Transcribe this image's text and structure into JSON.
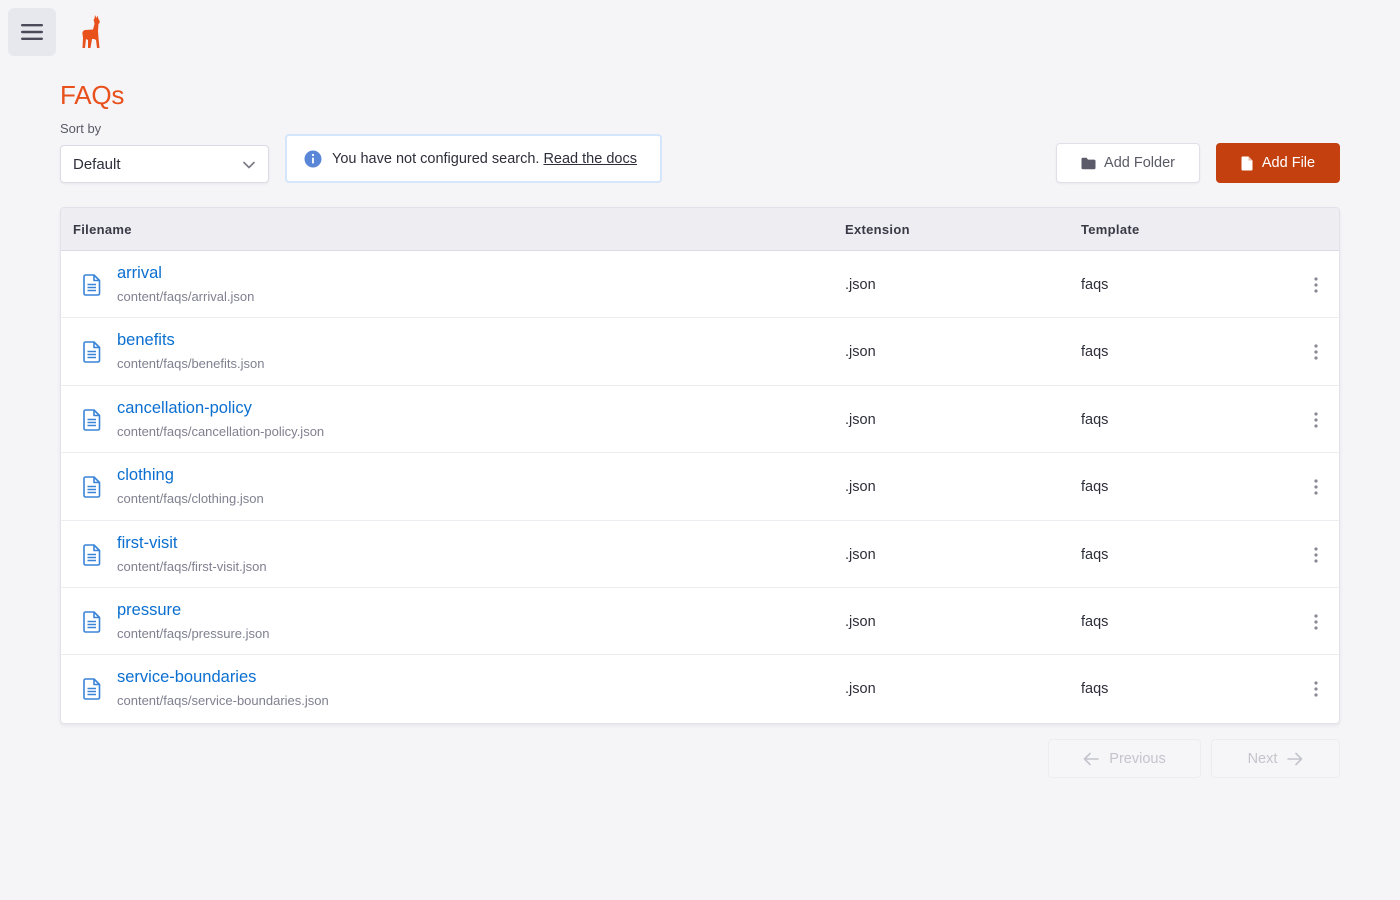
{
  "header": {
    "menu_icon": "hamburger-icon",
    "logo_icon": "llama-logo"
  },
  "page": {
    "title": "FAQs"
  },
  "sort": {
    "label": "Sort by",
    "value": "Default"
  },
  "notice": {
    "text": "You have not configured search.",
    "link": "Read the docs"
  },
  "actions": {
    "add_folder": "Add Folder",
    "add_file": "Add File"
  },
  "table": {
    "columns": {
      "filename": "Filename",
      "extension": "Extension",
      "template": "Template"
    },
    "rows": [
      {
        "name": "arrival",
        "path": "content/faqs/arrival.json",
        "ext": ".json",
        "template": "faqs"
      },
      {
        "name": "benefits",
        "path": "content/faqs/benefits.json",
        "ext": ".json",
        "template": "faqs"
      },
      {
        "name": "cancellation-policy",
        "path": "content/faqs/cancellation-policy.json",
        "ext": ".json",
        "template": "faqs"
      },
      {
        "name": "clothing",
        "path": "content/faqs/clothing.json",
        "ext": ".json",
        "template": "faqs"
      },
      {
        "name": "first-visit",
        "path": "content/faqs/first-visit.json",
        "ext": ".json",
        "template": "faqs"
      },
      {
        "name": "pressure",
        "path": "content/faqs/pressure.json",
        "ext": ".json",
        "template": "faqs"
      },
      {
        "name": "service-boundaries",
        "path": "content/faqs/service-boundaries.json",
        "ext": ".json",
        "template": "faqs"
      }
    ]
  },
  "pagination": {
    "previous": "Previous",
    "next": "Next"
  },
  "colors": {
    "accent": "#e8501c",
    "primary_button": "#c4410f",
    "link": "#0b6fd0",
    "background": "#f5f5f8"
  }
}
